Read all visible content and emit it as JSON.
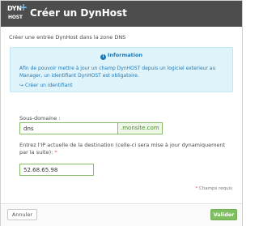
{
  "header": {
    "logo_main": "DYN",
    "logo_sub": "HOST",
    "logo_plus": "+",
    "title": "Créer un DynHost"
  },
  "subtitle": "Créer une entrée DynHost dans la zone DNS",
  "info": {
    "heading": "Information",
    "text": "Afin de pouvoir mettre à jour un champ DynHOST depuis un logiciel exterieur au Manager, un identifiant DynHOST est obligatoire.",
    "link": "Créer un identifiant"
  },
  "form": {
    "subdomain_label": "Sous-domaine :",
    "subdomain_value": "dns",
    "subdomain_suffix": ".monsite.com",
    "ip_label": "Entrez l'IP actuelle de la destination (celle-ci sera mise à jour dynamiquement par la suite):",
    "ip_required_mark": "*",
    "ip_value": "52.68.65.98"
  },
  "required_note": {
    "mark": "*",
    "text": "Champs requis"
  },
  "footer": {
    "cancel_label": "Annuler",
    "ok_label": "Valider"
  }
}
